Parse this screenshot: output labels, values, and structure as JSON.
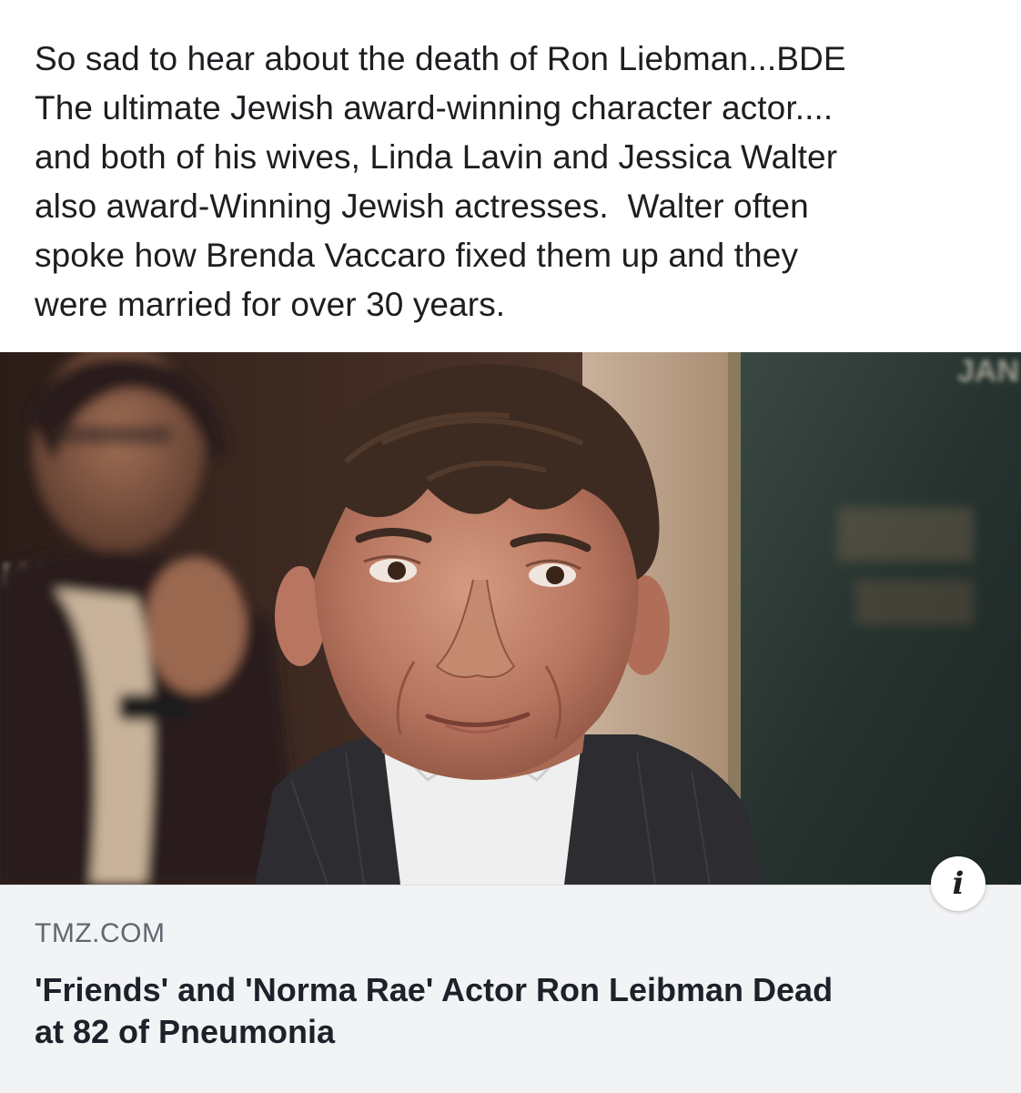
{
  "post": {
    "text_lines": [
      "So sad to hear about the death of Ron Liebman...BDE",
      "The ultimate Jewish award-winning character actor....",
      "and both of his wives, Linda Lavin and Jessica Walter",
      "also award-Winning Jewish actresses.  Walter often",
      "spoke how Brenda Vaccaro fixed them up and they",
      "were married for over 30 years."
    ]
  },
  "link_card": {
    "source": "TMZ.COM",
    "headline_lines": [
      "'Friends' and 'Norma Rae' Actor Ron Leibman Dead",
      "at 82 of Pneumonia"
    ],
    "info_icon": "info-icon",
    "info_glyph": "i"
  },
  "photo": {
    "background_text_top_right": "JAN",
    "background_text_left": "IAL"
  }
}
